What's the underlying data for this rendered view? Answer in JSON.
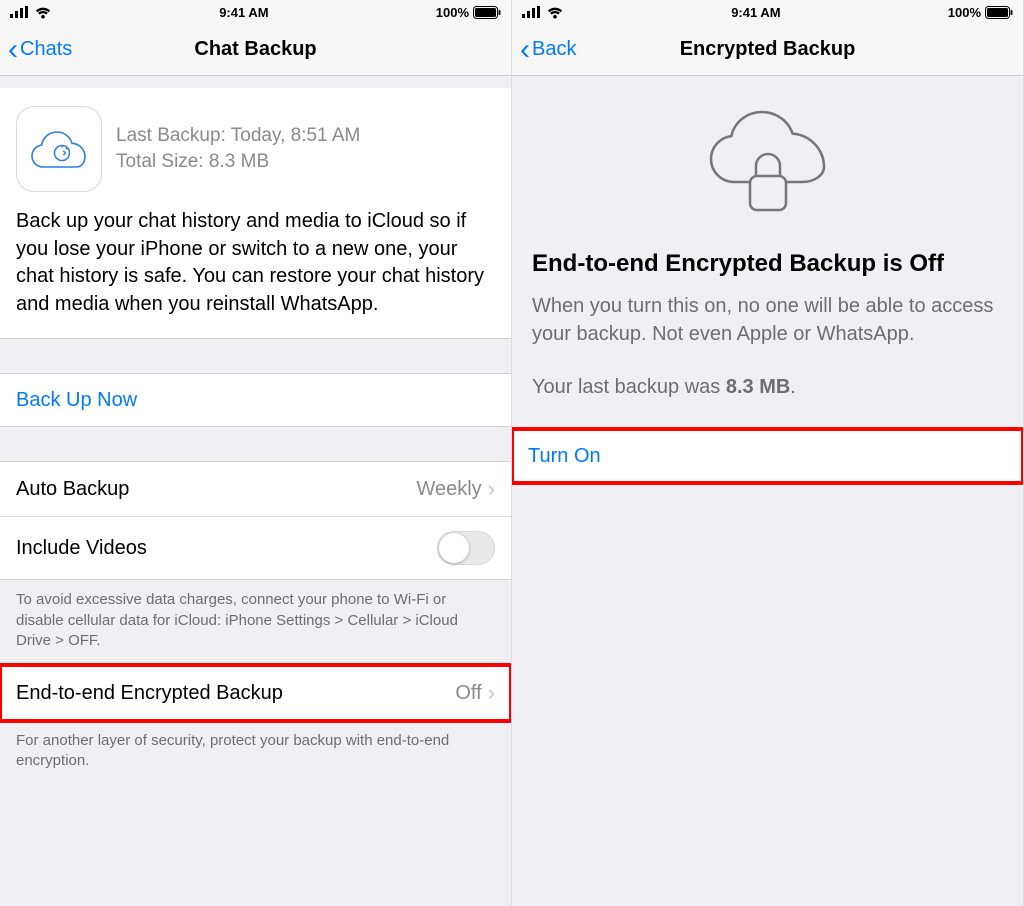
{
  "status": {
    "time": "9:41 AM",
    "battery": "100%"
  },
  "screen1": {
    "nav": {
      "back": "Chats",
      "title": "Chat Backup"
    },
    "info": {
      "last_backup_label": "Last Backup: Today, 8:51 AM",
      "total_size_label": "Total Size: 8.3 MB",
      "description": "Back up your chat history and media to iCloud so if you lose your iPhone or switch to a new one, your chat history is safe. You can restore your chat history and media when you reinstall WhatsApp."
    },
    "backup_now": "Back Up Now",
    "auto_backup": {
      "label": "Auto Backup",
      "value": "Weekly"
    },
    "include_videos": {
      "label": "Include Videos"
    },
    "data_note": "To avoid excessive data charges, connect your phone to Wi-Fi or disable cellular data for iCloud: iPhone Settings > Cellular > iCloud Drive > OFF.",
    "e2e": {
      "label": "End-to-end Encrypted Backup",
      "value": "Off"
    },
    "e2e_note": "For another layer of security, protect your backup with end-to-end encryption."
  },
  "screen2": {
    "nav": {
      "back": "Back",
      "title": "Encrypted Backup"
    },
    "hero": {
      "title": "End-to-end Encrypted Backup is Off",
      "description": "When you turn this on, no one will be able to access your backup. Not even Apple or WhatsApp.",
      "last_backup_prefix": "Your last backup was ",
      "last_backup_size": "8.3 MB",
      "last_backup_suffix": "."
    },
    "turn_on": "Turn On"
  }
}
